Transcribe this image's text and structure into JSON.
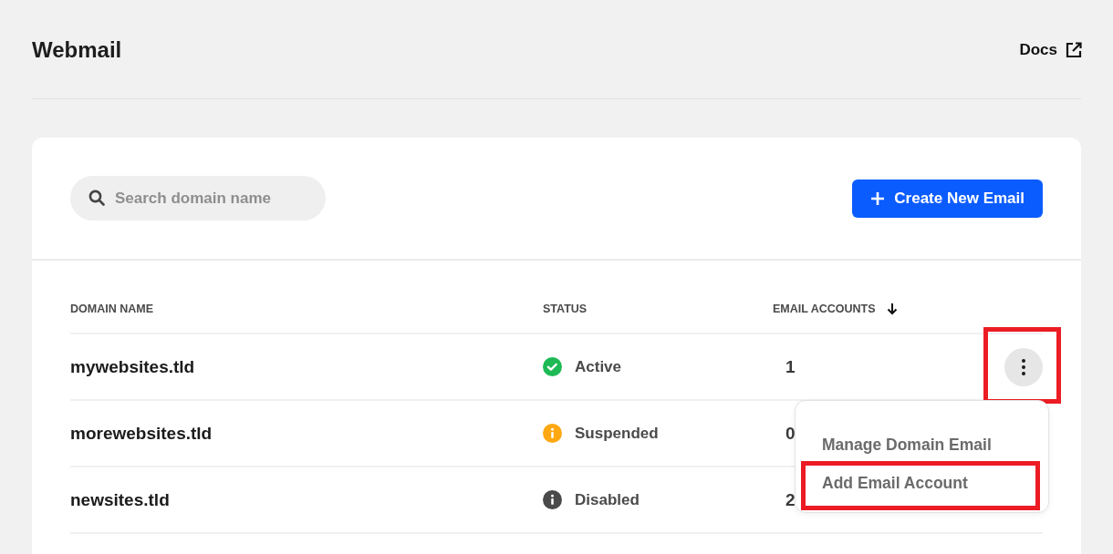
{
  "page": {
    "title": "Webmail",
    "docs_link": "Docs"
  },
  "toolbar": {
    "search": {
      "placeholder": "Search domain name"
    },
    "create_button": "Create New Email"
  },
  "table": {
    "columns": [
      {
        "label": "DOMAIN NAME",
        "sorted": false
      },
      {
        "label": "STATUS",
        "sorted": false
      },
      {
        "label": "EMAIL ACCOUNTS",
        "sorted": true
      }
    ],
    "rows": [
      {
        "domain": "mywebsites.tld",
        "status": {
          "kind": "check",
          "label": "Active",
          "color": "#1db954"
        },
        "accounts": "1",
        "menu_open": true,
        "highlighted": true
      },
      {
        "domain": "morewebsites.tld",
        "status": {
          "kind": "info",
          "label": "Suspended",
          "color": "#ffa812"
        },
        "accounts": "0",
        "menu_open": false,
        "highlighted": false
      },
      {
        "domain": "newsites.tld",
        "status": {
          "kind": "info",
          "label": "Disabled",
          "color": "#4a4a4a"
        },
        "accounts": "2",
        "menu_open": false,
        "highlighted": false
      }
    ]
  },
  "row_menu": {
    "items": [
      {
        "label": "Manage Domain Email",
        "highlighted": false
      },
      {
        "label": "Add Email Account",
        "highlighted": true
      }
    ]
  }
}
